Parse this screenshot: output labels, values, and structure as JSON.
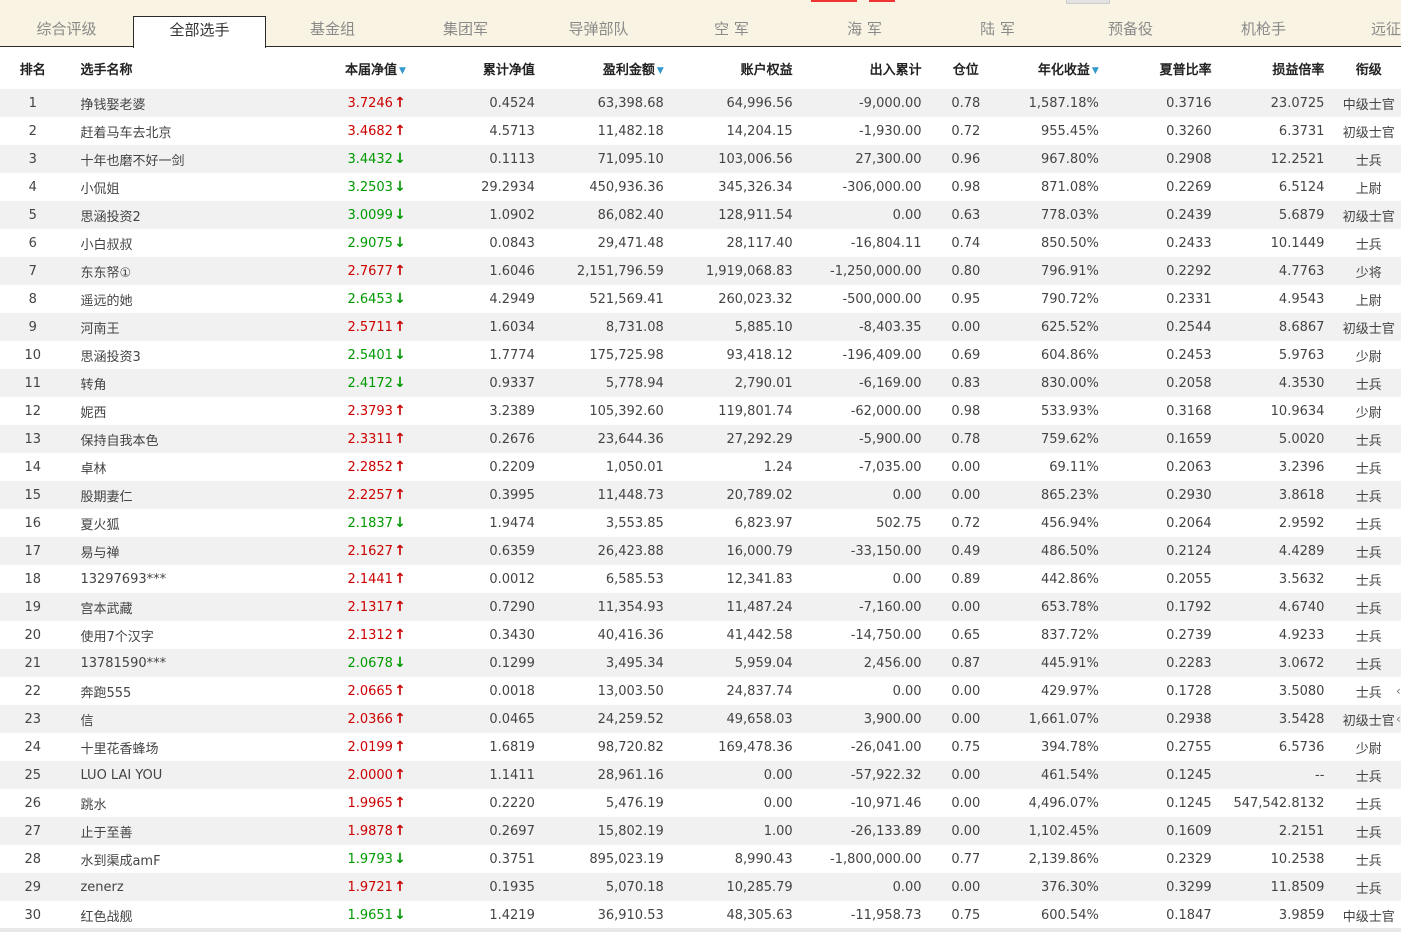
{
  "tabs": [
    {
      "label": "综合评级"
    },
    {
      "label": "全部选手"
    },
    {
      "label": "基金组"
    },
    {
      "label": "集团军"
    },
    {
      "label": "导弹部队"
    },
    {
      "label": "空 军"
    },
    {
      "label": "海 军"
    },
    {
      "label": "陆 军"
    },
    {
      "label": "预备役"
    },
    {
      "label": "机枪手"
    },
    {
      "label": "远征"
    }
  ],
  "active_tab": "全部选手",
  "colors": {
    "up": "#cc0000",
    "down": "#009900",
    "tab_bg": "#f8f3e2",
    "row_alt": "#f1f1f1",
    "sort_icon": "#3399cc"
  },
  "table": {
    "headers": {
      "rank": "排名",
      "name": "选手名称",
      "current_nav": "本届净值",
      "cum_nav": "累计净值",
      "profit": "盈利金额",
      "equity": "账户权益",
      "flow": "出入累计",
      "position": "仓位",
      "annual": "年化收益",
      "sharpe": "夏普比率",
      "pl_ratio": "损益倍率",
      "grade": "衔级"
    },
    "sorted_columns": [
      "current_nav",
      "profit",
      "annual"
    ],
    "rows": [
      {
        "rank": "1",
        "name": "挣钱娶老婆",
        "nav": "3.7246",
        "trend": "up",
        "cum": "0.4524",
        "profit": "63,398.68",
        "equity": "64,996.56",
        "flow": "-9,000.00",
        "pos": "0.78",
        "annual": "1,587.18%",
        "sharpe": "0.3716",
        "plr": "23.0725",
        "grade": "中级士官"
      },
      {
        "rank": "2",
        "name": "赶着马车去北京",
        "nav": "3.4682",
        "trend": "up",
        "cum": "4.5713",
        "profit": "11,482.18",
        "equity": "14,204.15",
        "flow": "-1,930.00",
        "pos": "0.72",
        "annual": "955.45%",
        "sharpe": "0.3260",
        "plr": "6.3731",
        "grade": "初级士官"
      },
      {
        "rank": "3",
        "name": "十年也磨不好一剑",
        "nav": "3.4432",
        "trend": "down",
        "cum": "0.1113",
        "profit": "71,095.10",
        "equity": "103,006.56",
        "flow": "27,300.00",
        "pos": "0.96",
        "annual": "967.80%",
        "sharpe": "0.2908",
        "plr": "12.2521",
        "grade": "士兵"
      },
      {
        "rank": "4",
        "name": "小侃姐",
        "nav": "3.2503",
        "trend": "down",
        "cum": "29.2934",
        "profit": "450,936.36",
        "equity": "345,326.34",
        "flow": "-306,000.00",
        "pos": "0.98",
        "annual": "871.08%",
        "sharpe": "0.2269",
        "plr": "6.5124",
        "grade": "上尉"
      },
      {
        "rank": "5",
        "name": "思涵投资2",
        "nav": "3.0099",
        "trend": "down",
        "cum": "1.0902",
        "profit": "86,082.40",
        "equity": "128,911.54",
        "flow": "0.00",
        "pos": "0.63",
        "annual": "778.03%",
        "sharpe": "0.2439",
        "plr": "5.6879",
        "grade": "初级士官"
      },
      {
        "rank": "6",
        "name": "小白叔叔",
        "nav": "2.9075",
        "trend": "down",
        "cum": "0.0843",
        "profit": "29,471.48",
        "equity": "28,117.40",
        "flow": "-16,804.11",
        "pos": "0.74",
        "annual": "850.50%",
        "sharpe": "0.2433",
        "plr": "10.1449",
        "grade": "士兵"
      },
      {
        "rank": "7",
        "name": "东东帑①",
        "nav": "2.7677",
        "trend": "up",
        "cum": "1.6046",
        "profit": "2,151,796.59",
        "equity": "1,919,068.83",
        "flow": "-1,250,000.00",
        "pos": "0.80",
        "annual": "796.91%",
        "sharpe": "0.2292",
        "plr": "4.7763",
        "grade": "少将"
      },
      {
        "rank": "8",
        "name": "遥远的她",
        "nav": "2.6453",
        "trend": "down",
        "cum": "4.2949",
        "profit": "521,569.41",
        "equity": "260,023.32",
        "flow": "-500,000.00",
        "pos": "0.95",
        "annual": "790.72%",
        "sharpe": "0.2331",
        "plr": "4.9543",
        "grade": "上尉"
      },
      {
        "rank": "9",
        "name": "河南王",
        "nav": "2.5711",
        "trend": "up",
        "cum": "1.6034",
        "profit": "8,731.08",
        "equity": "5,885.10",
        "flow": "-8,403.35",
        "pos": "0.00",
        "annual": "625.52%",
        "sharpe": "0.2544",
        "plr": "8.6867",
        "grade": "初级士官"
      },
      {
        "rank": "10",
        "name": "思涵投资3",
        "nav": "2.5401",
        "trend": "down",
        "cum": "1.7774",
        "profit": "175,725.98",
        "equity": "93,418.12",
        "flow": "-196,409.00",
        "pos": "0.69",
        "annual": "604.86%",
        "sharpe": "0.2453",
        "plr": "5.9763",
        "grade": "少尉"
      },
      {
        "rank": "11",
        "name": "转角",
        "nav": "2.4172",
        "trend": "down",
        "cum": "0.9337",
        "profit": "5,778.94",
        "equity": "2,790.01",
        "flow": "-6,169.00",
        "pos": "0.83",
        "annual": "830.00%",
        "sharpe": "0.2058",
        "plr": "4.3530",
        "grade": "士兵"
      },
      {
        "rank": "12",
        "name": "妮西",
        "nav": "2.3793",
        "trend": "up",
        "cum": "3.2389",
        "profit": "105,392.60",
        "equity": "119,801.74",
        "flow": "-62,000.00",
        "pos": "0.98",
        "annual": "533.93%",
        "sharpe": "0.3168",
        "plr": "10.9634",
        "grade": "少尉"
      },
      {
        "rank": "13",
        "name": "保持自我本色",
        "nav": "2.3311",
        "trend": "up",
        "cum": "0.2676",
        "profit": "23,644.36",
        "equity": "27,292.29",
        "flow": "-5,900.00",
        "pos": "0.78",
        "annual": "759.62%",
        "sharpe": "0.1659",
        "plr": "5.0020",
        "grade": "士兵"
      },
      {
        "rank": "14",
        "name": "卓林",
        "nav": "2.2852",
        "trend": "up",
        "cum": "0.2209",
        "profit": "1,050.01",
        "equity": "1.24",
        "flow": "-7,035.00",
        "pos": "0.00",
        "annual": "69.11%",
        "sharpe": "0.2063",
        "plr": "3.2396",
        "grade": "士兵"
      },
      {
        "rank": "15",
        "name": "股期妻仁",
        "nav": "2.2257",
        "trend": "up",
        "cum": "0.3995",
        "profit": "11,448.73",
        "equity": "20,789.02",
        "flow": "0.00",
        "pos": "0.00",
        "annual": "865.23%",
        "sharpe": "0.2930",
        "plr": "3.8618",
        "grade": "士兵"
      },
      {
        "rank": "16",
        "name": "夏火狐",
        "nav": "2.1837",
        "trend": "down",
        "cum": "1.9474",
        "profit": "3,553.85",
        "equity": "6,823.97",
        "flow": "502.75",
        "pos": "0.72",
        "annual": "456.94%",
        "sharpe": "0.2064",
        "plr": "2.9592",
        "grade": "士兵"
      },
      {
        "rank": "17",
        "name": "易与禅",
        "nav": "2.1627",
        "trend": "up",
        "cum": "0.6359",
        "profit": "26,423.88",
        "equity": "16,000.79",
        "flow": "-33,150.00",
        "pos": "0.49",
        "annual": "486.50%",
        "sharpe": "0.2124",
        "plr": "4.4289",
        "grade": "士兵"
      },
      {
        "rank": "18",
        "name": "13297693***",
        "nav": "2.1441",
        "trend": "up",
        "cum": "0.0012",
        "profit": "6,585.53",
        "equity": "12,341.83",
        "flow": "0.00",
        "pos": "0.89",
        "annual": "442.86%",
        "sharpe": "0.2055",
        "plr": "3.5632",
        "grade": "士兵"
      },
      {
        "rank": "19",
        "name": "宫本武藏",
        "nav": "2.1317",
        "trend": "up",
        "cum": "0.7290",
        "profit": "11,354.93",
        "equity": "11,487.24",
        "flow": "-7,160.00",
        "pos": "0.00",
        "annual": "653.78%",
        "sharpe": "0.1792",
        "plr": "4.6740",
        "grade": "士兵"
      },
      {
        "rank": "20",
        "name": "使用7个汉字",
        "nav": "2.1312",
        "trend": "up",
        "cum": "0.3430",
        "profit": "40,416.36",
        "equity": "41,442.58",
        "flow": "-14,750.00",
        "pos": "0.65",
        "annual": "837.72%",
        "sharpe": "0.2739",
        "plr": "4.9233",
        "grade": "士兵"
      },
      {
        "rank": "21",
        "name": "13781590***",
        "nav": "2.0678",
        "trend": "down",
        "cum": "0.1299",
        "profit": "3,495.34",
        "equity": "5,959.04",
        "flow": "2,456.00",
        "pos": "0.87",
        "annual": "445.91%",
        "sharpe": "0.2283",
        "plr": "3.0672",
        "grade": "士兵"
      },
      {
        "rank": "22",
        "name": "奔跑555",
        "nav": "2.0665",
        "trend": "up",
        "cum": "0.0018",
        "profit": "13,003.50",
        "equity": "24,837.74",
        "flow": "0.00",
        "pos": "0.00",
        "annual": "429.97%",
        "sharpe": "0.1728",
        "plr": "3.5080",
        "grade": "士兵"
      },
      {
        "rank": "23",
        "name": "信",
        "nav": "2.0366",
        "trend": "up",
        "cum": "0.0465",
        "profit": "24,259.52",
        "equity": "49,658.03",
        "flow": "3,900.00",
        "pos": "0.00",
        "annual": "1,661.07%",
        "sharpe": "0.2938",
        "plr": "3.5428",
        "grade": "初级士官"
      },
      {
        "rank": "24",
        "name": "十里花香蜂场",
        "nav": "2.0199",
        "trend": "up",
        "cum": "1.6819",
        "profit": "98,720.82",
        "equity": "169,478.36",
        "flow": "-26,041.00",
        "pos": "0.75",
        "annual": "394.78%",
        "sharpe": "0.2755",
        "plr": "6.5736",
        "grade": "少尉"
      },
      {
        "rank": "25",
        "name": "LUO LAI YOU",
        "nav": "2.0000",
        "trend": "up",
        "cum": "1.1411",
        "profit": "28,961.16",
        "equity": "0.00",
        "flow": "-57,922.32",
        "pos": "0.00",
        "annual": "461.54%",
        "sharpe": "0.1245",
        "plr": "--",
        "grade": "士兵"
      },
      {
        "rank": "26",
        "name": "跳水",
        "nav": "1.9965",
        "trend": "up",
        "cum": "0.2220",
        "profit": "5,476.19",
        "equity": "0.00",
        "flow": "-10,971.46",
        "pos": "0.00",
        "annual": "4,496.07%",
        "sharpe": "0.1245",
        "plr": "547,542.8132",
        "grade": "士兵"
      },
      {
        "rank": "27",
        "name": "止于至善",
        "nav": "1.9878",
        "trend": "up",
        "cum": "0.2697",
        "profit": "15,802.19",
        "equity": "1.00",
        "flow": "-26,133.89",
        "pos": "0.00",
        "annual": "1,102.45%",
        "sharpe": "0.1609",
        "plr": "2.2151",
        "grade": "士兵"
      },
      {
        "rank": "28",
        "name": "水到渠成amF",
        "nav": "1.9793",
        "trend": "down",
        "cum": "0.3751",
        "profit": "895,023.19",
        "equity": "8,990.43",
        "flow": "-1,800,000.00",
        "pos": "0.77",
        "annual": "2,139.86%",
        "sharpe": "0.2329",
        "plr": "10.2538",
        "grade": "士兵"
      },
      {
        "rank": "29",
        "name": "zenerz",
        "nav": "1.9721",
        "trend": "up",
        "cum": "0.1935",
        "profit": "5,070.18",
        "equity": "10,285.79",
        "flow": "0.00",
        "pos": "0.00",
        "annual": "376.30%",
        "sharpe": "0.3299",
        "plr": "11.8509",
        "grade": "士兵"
      },
      {
        "rank": "30",
        "name": "红色战舰",
        "nav": "1.9651",
        "trend": "down",
        "cum": "1.4219",
        "profit": "36,910.53",
        "equity": "48,305.63",
        "flow": "-11,958.73",
        "pos": "0.75",
        "annual": "600.54%",
        "sharpe": "0.1847",
        "plr": "3.9859",
        "grade": "中级士官"
      }
    ]
  }
}
